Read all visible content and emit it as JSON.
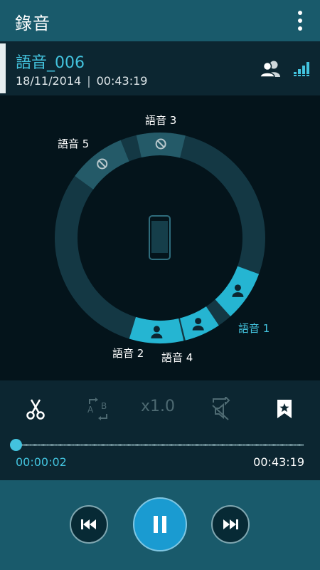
{
  "app": {
    "title": "錄音"
  },
  "recording": {
    "name": "語音_006",
    "date": "18/11/2014",
    "separator": "|",
    "duration": "00:43:19"
  },
  "segments": [
    {
      "label": "語音 3",
      "state": "muted"
    },
    {
      "label": "語音 5",
      "state": "muted"
    },
    {
      "label": "語音 1",
      "state": "active"
    },
    {
      "label": "語音 2",
      "state": "active"
    },
    {
      "label": "語音 4",
      "state": "active"
    }
  ],
  "controls": {
    "trim_icon": "scissors-icon",
    "repeat_icon": "ab-repeat-icon",
    "speed": "x1.0",
    "skip_silence_icon": "skip-silence-icon",
    "bookmark_icon": "bookmark-icon"
  },
  "playback": {
    "current_time": "00:00:02",
    "total_time": "00:43:19",
    "progress": 0.001
  },
  "colors": {
    "accent": "#43c3de",
    "bar": "#195a6b",
    "panel": "#0c2631",
    "background": "#04141b",
    "ring": "#143844",
    "active_segment": "#25b5d2",
    "muted_segment": "#245a68",
    "play_button": "#1a9bd1"
  }
}
